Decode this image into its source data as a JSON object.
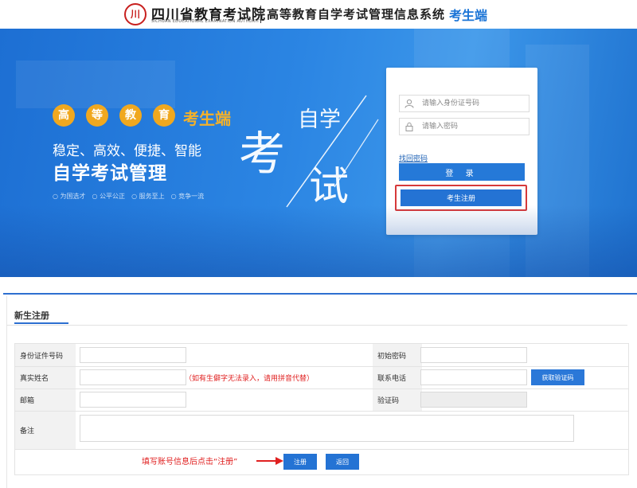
{
  "header": {
    "logo_mark": "川",
    "org_name": "四川省教育考试院",
    "org_name_en": "SICHUAN EDUCATIONAL EXAMINATION AUTHORITY",
    "system_name": "高等教育自学考试管理信息系统",
    "portal": "考生端"
  },
  "banner": {
    "circle_chars": [
      "高",
      "等",
      "教",
      "育"
    ],
    "portal": "考生端",
    "slogan": "稳定、高效、便捷、智能",
    "title": "自学考试管理",
    "tags": [
      "为国选才",
      "公平公正",
      "服务至上",
      "竞争一流"
    ],
    "art_text": {
      "top": "自学",
      "left": "考",
      "right": "试"
    }
  },
  "login": {
    "id_placeholder": "请输入身份证号码",
    "password_placeholder": "请输入密码",
    "forgot_link": "找回密码",
    "login_button": "登 录",
    "register_button": "考生注册",
    "highlight_color": "#d6393a"
  },
  "form": {
    "tab": "新生注册",
    "rows": {
      "id_card_label": "身份证件号码",
      "initial_password_label": "初始密码",
      "real_name_label": "真实姓名",
      "name_hint": "（如有生僻字无法录入，请用拼音代替）",
      "phone_label": "联系电话",
      "sms_button": "获取验证码",
      "email_label": "邮箱",
      "code_label": "验证码",
      "remark_label": "备注"
    },
    "footer_hint": "填写账号信息后点击“注册”",
    "register_button": "注册",
    "back_button": "返回"
  },
  "colors": {
    "accent": "#2473d4",
    "warning": "#e02020",
    "gold": "#f0a81f"
  }
}
